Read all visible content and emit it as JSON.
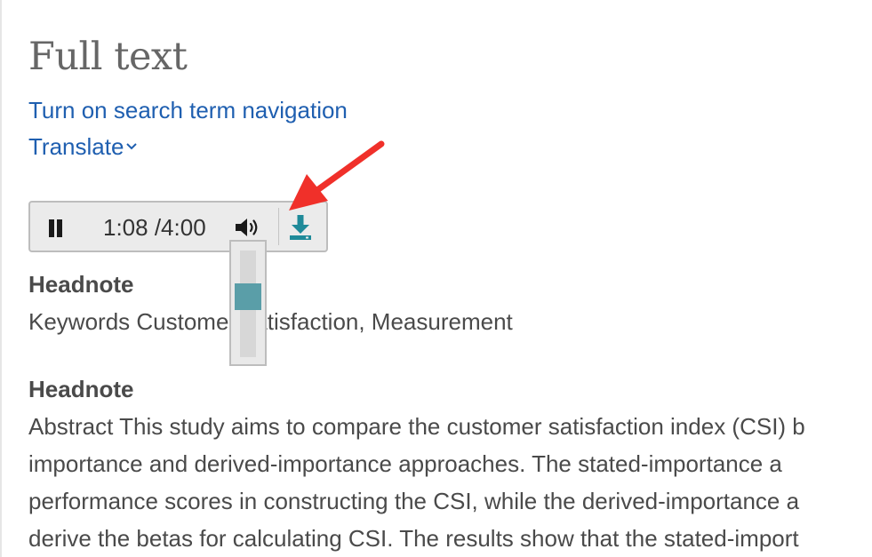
{
  "page": {
    "title": "Full text",
    "search_link": "Turn on search term navigation",
    "translate_link": "Translate"
  },
  "player": {
    "time": "1:08 /4:00",
    "volume_level_fraction": 0.45,
    "accent_color": "#5a9ea8"
  },
  "sections": [
    {
      "heading": "Headnote",
      "text": "Keywords Customer satisfaction, Measurement"
    },
    {
      "heading": "Headnote",
      "lines": [
        "Abstract This study aims to compare the customer satisfaction index (CSI) b",
        " importance  and derived-importance  approaches. The stated-importance  a",
        "performance scores in constructing the CSI, while the derived-importance  a",
        "derive the betas for calculating CSI. The results show that the stated-import"
      ]
    }
  ],
  "annotation": {
    "arrow_color": "#f0302a"
  },
  "colors": {
    "link": "#1f5fb0",
    "title": "#666666",
    "body": "#4a4a4a"
  }
}
